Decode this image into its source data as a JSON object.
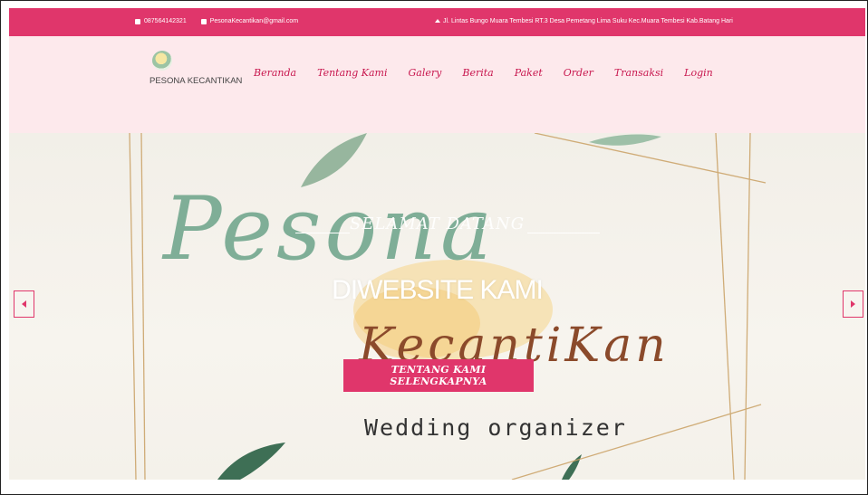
{
  "topbar": {
    "phone": "087564142321",
    "email": "PesonaKecantikan@gmail.com",
    "address": "Jl. Lintas Bungo Muara Tembesi RT.3 Desa Pemetang Lima Suku Kec.Muara Tembesi Kab.Batang Hari",
    "icons": [
      "phone-icon",
      "mail-icon",
      "home-icon"
    ]
  },
  "brand": {
    "name": "PESONA KECANTIKAN"
  },
  "nav": {
    "items": [
      {
        "label": "Beranda"
      },
      {
        "label": "Tentang Kami"
      },
      {
        "label": "Galery"
      },
      {
        "label": "Berita"
      },
      {
        "label": "Paket"
      },
      {
        "label": "Order"
      },
      {
        "label": "Transaksi"
      },
      {
        "label": "Login"
      }
    ]
  },
  "hero": {
    "subtitle": "SELAMAT DATANG",
    "title": "DIWEBSITE KAMI",
    "cta": "TENTANG KAMI SELENGKAPNYA",
    "art": {
      "script_word_1": "Pesona",
      "script_word_2": "KecantiKan",
      "tagline": "Wedding organizer"
    },
    "prev_icon": "chevron-left-icon",
    "next_icon": "chevron-right-icon"
  },
  "colors": {
    "accent": "#e0366b",
    "nav_bg": "#fde9ec",
    "nav_text": "#c8184f"
  }
}
